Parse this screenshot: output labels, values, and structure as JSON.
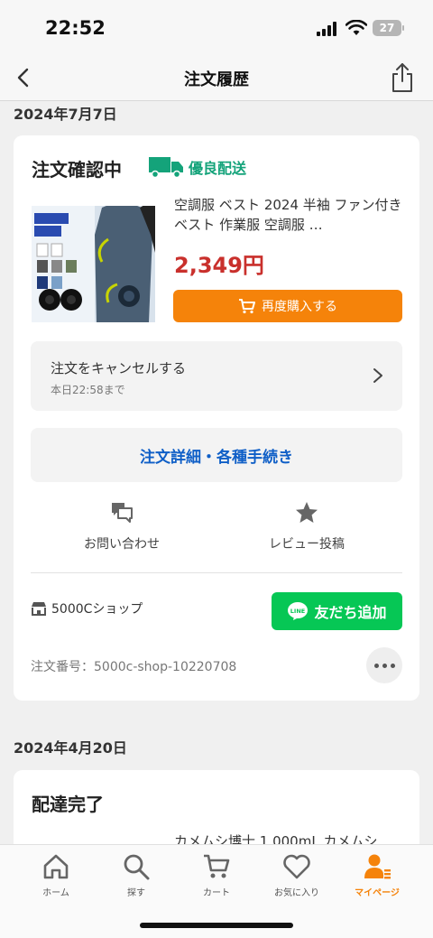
{
  "status_bar": {
    "time": "22:52",
    "battery": "27"
  },
  "nav": {
    "title": "注文履歴"
  },
  "orders": [
    {
      "date": "2024年7月7日",
      "status": "注文確認中",
      "shipping_badge": "優良配送",
      "product": {
        "name": "空調服 ベスト 2024 半袖 ファン付きベスト 作業服 空調服 …",
        "price": "2,349円",
        "image_text": {
          "headline": "夏を涼しく快適に",
          "sizes": "S~3XL 7タイプ",
          "year": "2023 最新作",
          "fan": "ファン付き",
          "usb": "USB給電式"
        }
      },
      "rebuy_label": "再度購入する",
      "cancel": {
        "title": "注文をキャンセルする",
        "deadline": "本日22:58まで"
      },
      "details_label": "注文詳細・各種手続き",
      "actions": [
        {
          "label": "お問い合わせ",
          "icon": "chat-icon"
        },
        {
          "label": "レビュー投稿",
          "icon": "star-icon"
        }
      ],
      "shop_name": "5000Cショップ",
      "line_button": {
        "badge": "LINE",
        "label": "友だち追加"
      },
      "order_number": "注文番号：5000c-shop-10220708"
    },
    {
      "date": "2024年4月20日",
      "status": "配達完了",
      "product": {
        "name": "カメムシ博士 1,000mL カメムシ"
      }
    }
  ],
  "tabs": [
    {
      "label": "ホーム",
      "icon": "home-icon",
      "active": false
    },
    {
      "label": "探す",
      "icon": "search-icon",
      "active": false
    },
    {
      "label": "カート",
      "icon": "cart-icon",
      "active": false
    },
    {
      "label": "お気に入り",
      "icon": "heart-icon",
      "active": false
    },
    {
      "label": "マイページ",
      "icon": "person-icon",
      "active": true
    }
  ],
  "colors": {
    "accent": "#f5830a",
    "price": "#c9302c",
    "link": "#0f5fc7",
    "line": "#06c755",
    "shipping": "#14a37a"
  }
}
